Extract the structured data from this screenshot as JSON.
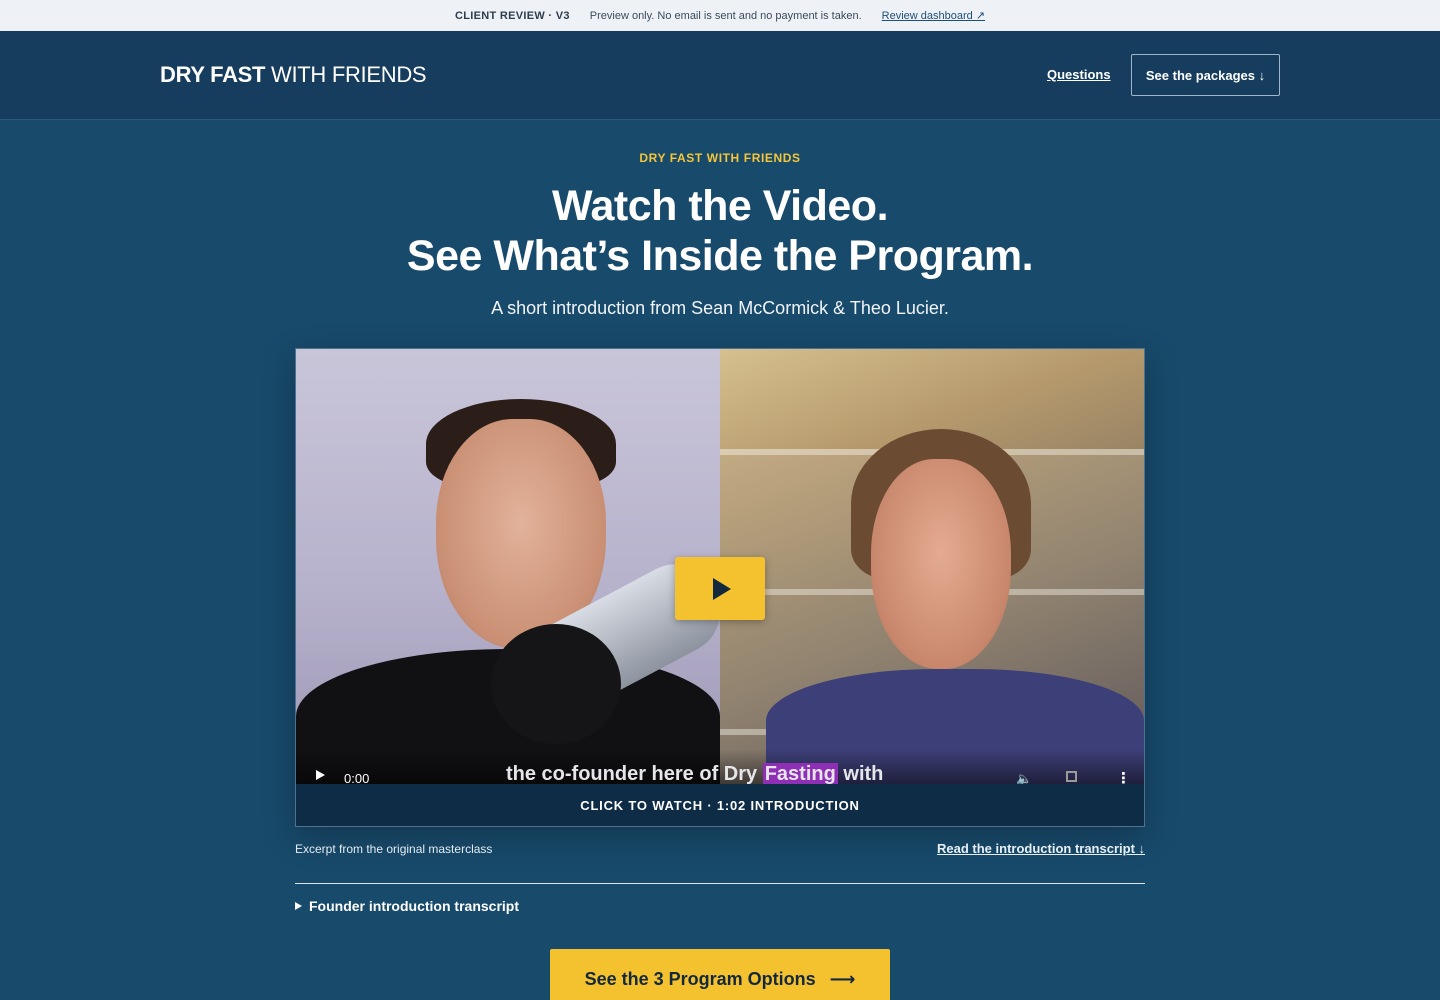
{
  "review_bar": {
    "tag": "CLIENT REVIEW · V3",
    "note": "Preview only. No email is sent and no payment is taken.",
    "link": "Review dashboard ↗"
  },
  "header": {
    "logo_bold": "DRY FAST",
    "logo_light": "WITH FRIENDS",
    "nav_questions": "Questions",
    "nav_packages": "See the packages ↓"
  },
  "hero": {
    "eyebrow": "DRY FAST WITH FRIENDS",
    "headline_line1": "Watch the Video.",
    "headline_line2": "See What’s Inside the Program.",
    "subhead": "A short introduction from Sean McCormick & Theo Lucier."
  },
  "video": {
    "current_time": "0:00",
    "caption_pre": "the co-founder here of Dry ",
    "caption_highlight": "Fasting",
    "caption_post": " with",
    "watch_label": "CLICK TO WATCH · 1:02 INTRODUCTION",
    "more_icon": "⋮",
    "volume_icon": "🔈"
  },
  "below_video": {
    "excerpt": "Excerpt from the original masterclass",
    "transcript_link": "Read the introduction transcript ↓",
    "details_summary": "Founder introduction transcript"
  },
  "cta": {
    "label": "See the 3 Program Options",
    "arrow": "⟶"
  },
  "colors": {
    "page_bg": "#184a6b",
    "header_bg": "#163d5d",
    "accent_yellow": "#f5c22f",
    "eyebrow_yellow": "#f5c53a"
  }
}
